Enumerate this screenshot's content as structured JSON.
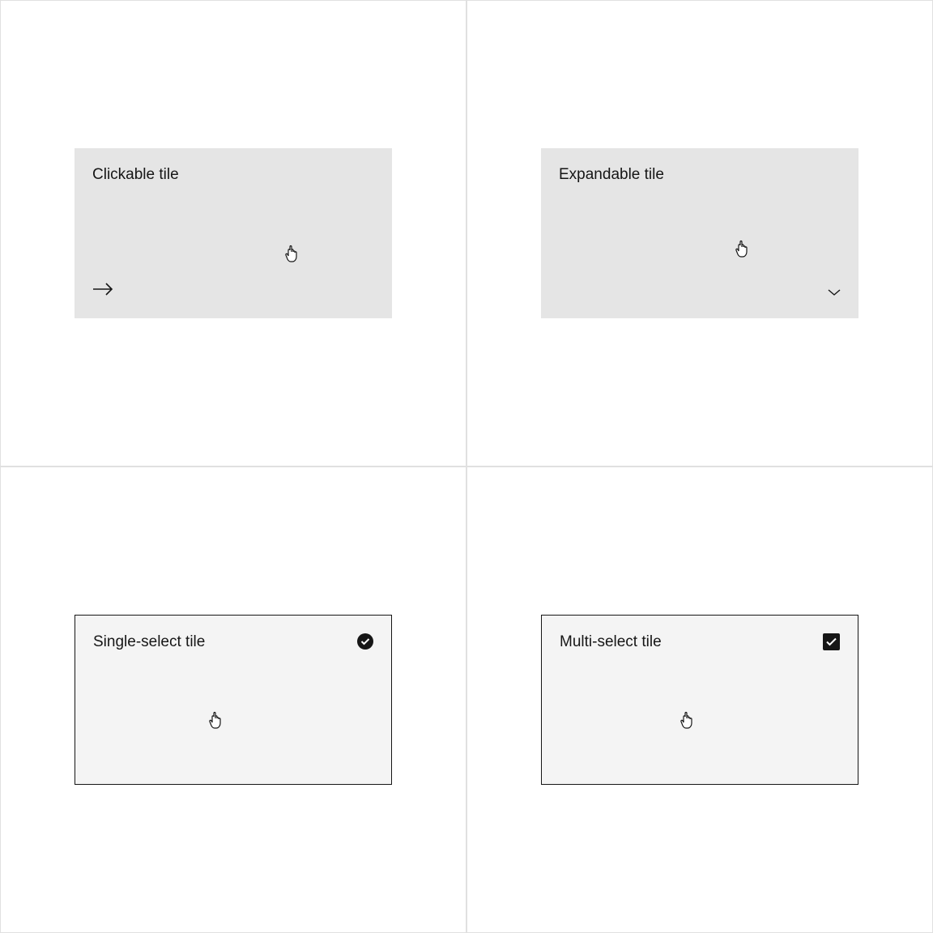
{
  "tiles": {
    "clickable": {
      "title": "Clickable tile"
    },
    "expandable": {
      "title": "Expandable tile"
    },
    "single_select": {
      "title": "Single-select tile"
    },
    "multi_select": {
      "title": "Multi-select tile"
    }
  }
}
